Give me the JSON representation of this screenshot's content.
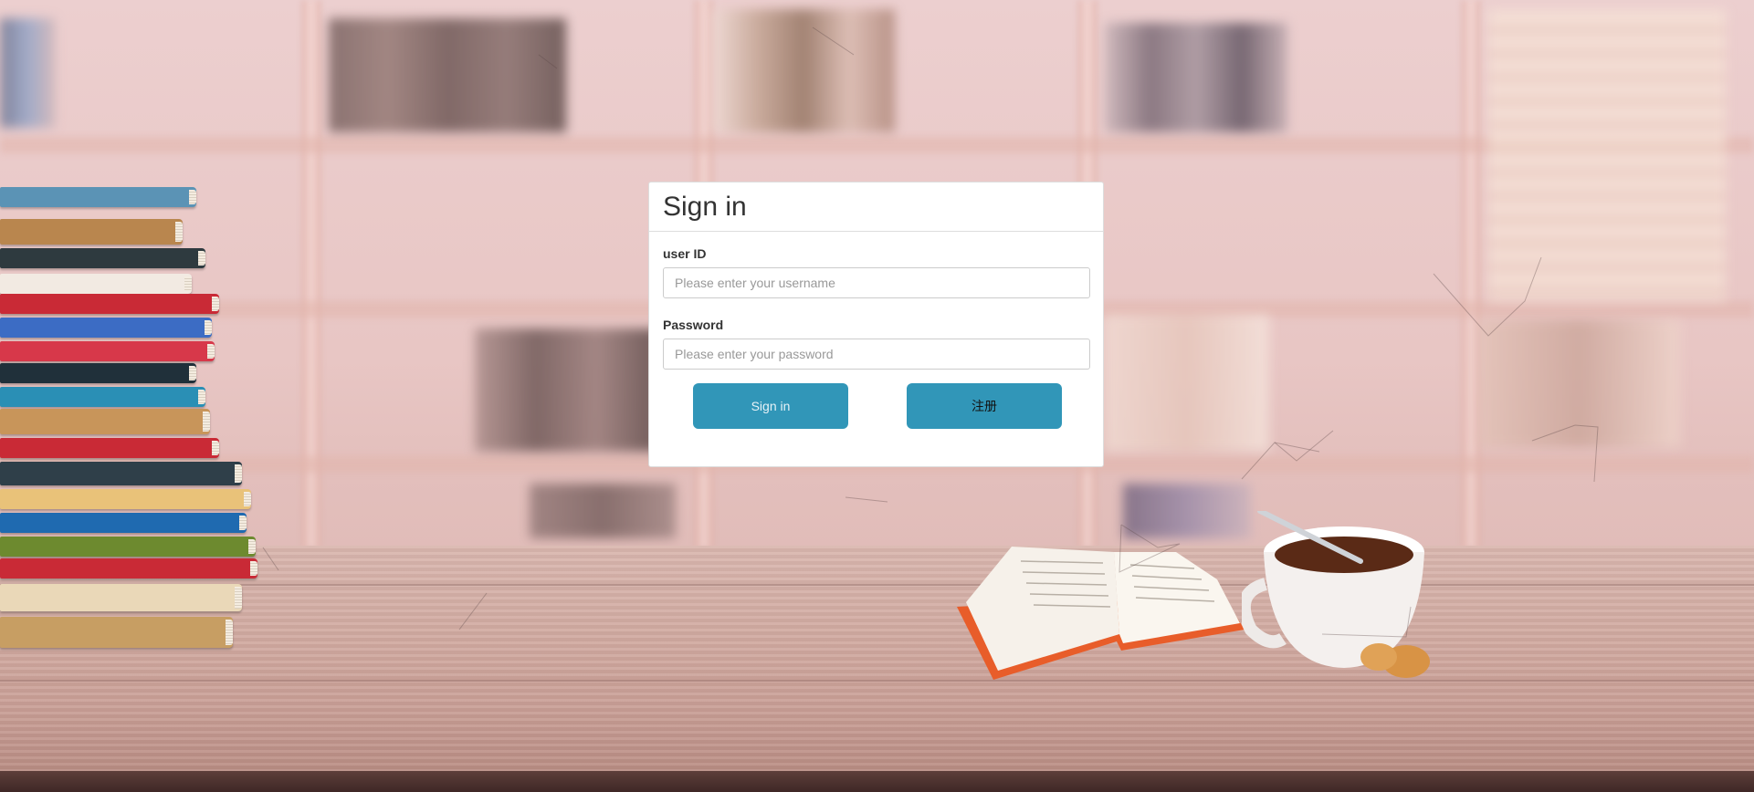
{
  "login": {
    "title": "Sign in",
    "user_label": "user ID",
    "user_placeholder": "Please enter your username",
    "user_value": "",
    "password_label": "Password",
    "password_placeholder": "Please enter your password",
    "password_value": "",
    "signin_label": "Sign in",
    "register_label": "注册"
  },
  "colors": {
    "button": "#3196b8",
    "panel_border": "#dddddd"
  }
}
